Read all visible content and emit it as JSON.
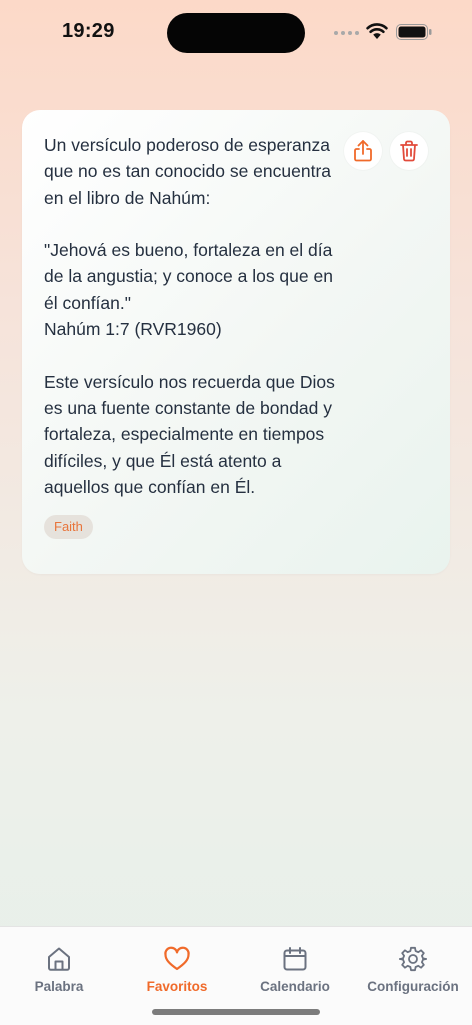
{
  "status_bar": {
    "time": "19:29"
  },
  "card": {
    "text": "Un versículo poderoso de esperanza que no es tan conocido se encuentra en el libro de Nahúm:\n\n\"Jehová es bueno, fortaleza en el día de la angustia; y conoce a los que en él confían.\"\nNahúm 1:7 (RVR1960)\n\nEste versículo nos recuerda que Dios es una fuente constante de bondad y fortaleza, especialmente en tiempos difíciles, y que Él está atento a aquellos que confían en Él.",
    "tag": "Faith",
    "share_icon": "share-icon",
    "delete_icon": "trash-icon"
  },
  "tabs": [
    {
      "label": "Palabra",
      "icon": "home-icon",
      "active": false
    },
    {
      "label": "Favoritos",
      "icon": "heart-icon",
      "active": true
    },
    {
      "label": "Calendario",
      "icon": "calendar-icon",
      "active": false
    },
    {
      "label": "Configuración",
      "icon": "gear-icon",
      "active": false
    }
  ],
  "colors": {
    "accent": "#f06a2a",
    "inactive_tab": "#6b7280",
    "delete": "#e24b3b"
  }
}
